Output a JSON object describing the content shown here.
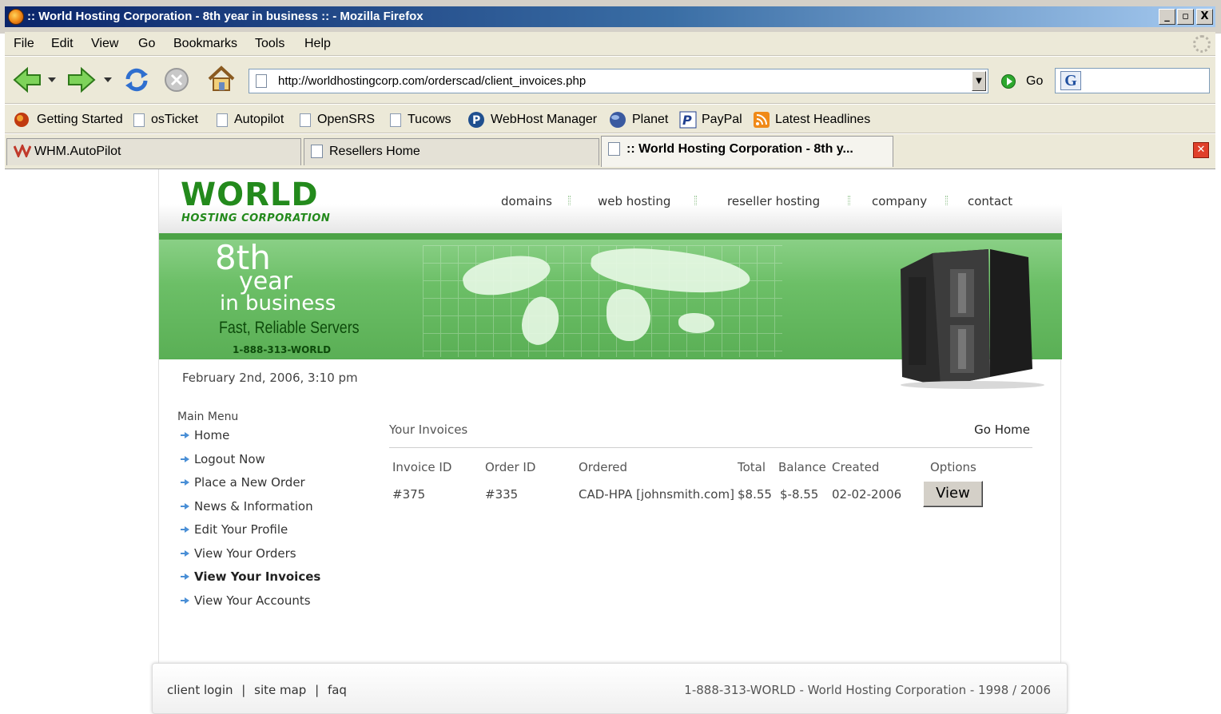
{
  "window": {
    "title": ":: World Hosting Corporation - 8th year in business :: - Mozilla Firefox",
    "minimize": "_",
    "maximize": "▫",
    "close": "X"
  },
  "menu": [
    "File",
    "Edit",
    "View",
    "Go",
    "Bookmarks",
    "Tools",
    "Help"
  ],
  "toolbar": {
    "url": "http://worldhostingcorp.com/orderscad/client_invoices.php",
    "go_label": "Go",
    "search_engine": "G"
  },
  "bookmarks": [
    "Getting Started",
    "osTicket",
    "Autopilot",
    "OpenSRS",
    "Tucows",
    "WebHost Manager",
    "Planet",
    "PayPal",
    "Latest Headlines"
  ],
  "tabs": [
    {
      "label": "WHM.AutoPilot",
      "active": false
    },
    {
      "label": "Resellers Home",
      "active": false
    },
    {
      "label": ":: World Hosting Corporation - 8th y...",
      "active": true
    }
  ],
  "site": {
    "logo_main": "WORLD",
    "logo_sub": "HOSTING CORPORATION",
    "nav": [
      "domains",
      "web hosting",
      "reseller hosting",
      "company",
      "contact"
    ],
    "banner": {
      "line1": "8th",
      "line2": "year",
      "line3": "in business",
      "tagline": "Fast, Reliable Servers",
      "phone": "1-888-313-WORLD"
    },
    "datetime": "February 2nd, 2006, 3:10 pm",
    "main_menu_title": "Main Menu",
    "main_menu": [
      {
        "label": "Home",
        "current": false
      },
      {
        "label": "Logout Now",
        "current": false
      },
      {
        "label": "Place a New Order",
        "current": false
      },
      {
        "label": "News & Information",
        "current": false
      },
      {
        "label": "Edit Your Profile",
        "current": false
      },
      {
        "label": "View Your Orders",
        "current": false
      },
      {
        "label": "View Your Invoices",
        "current": true
      },
      {
        "label": "View Your Accounts",
        "current": false
      }
    ],
    "invoices": {
      "title": "Your Invoices",
      "go_home": "Go Home",
      "headers": [
        "Invoice ID",
        "Order ID",
        "Ordered",
        "Total",
        "Balance",
        "Created",
        "Options"
      ],
      "rows": [
        {
          "invoice_id": "#375",
          "order_id": "#335",
          "ordered": "CAD-HPA [johnsmith.com]",
          "total": "$8.55",
          "balance": "$-8.55",
          "created": "02-02-2006",
          "option": "View"
        }
      ]
    },
    "footer": {
      "links": [
        "client login",
        "site map",
        "faq"
      ],
      "separator": "|",
      "copyright": "1-888-313-WORLD - World Hosting Corporation - 1998 / 2006"
    }
  }
}
